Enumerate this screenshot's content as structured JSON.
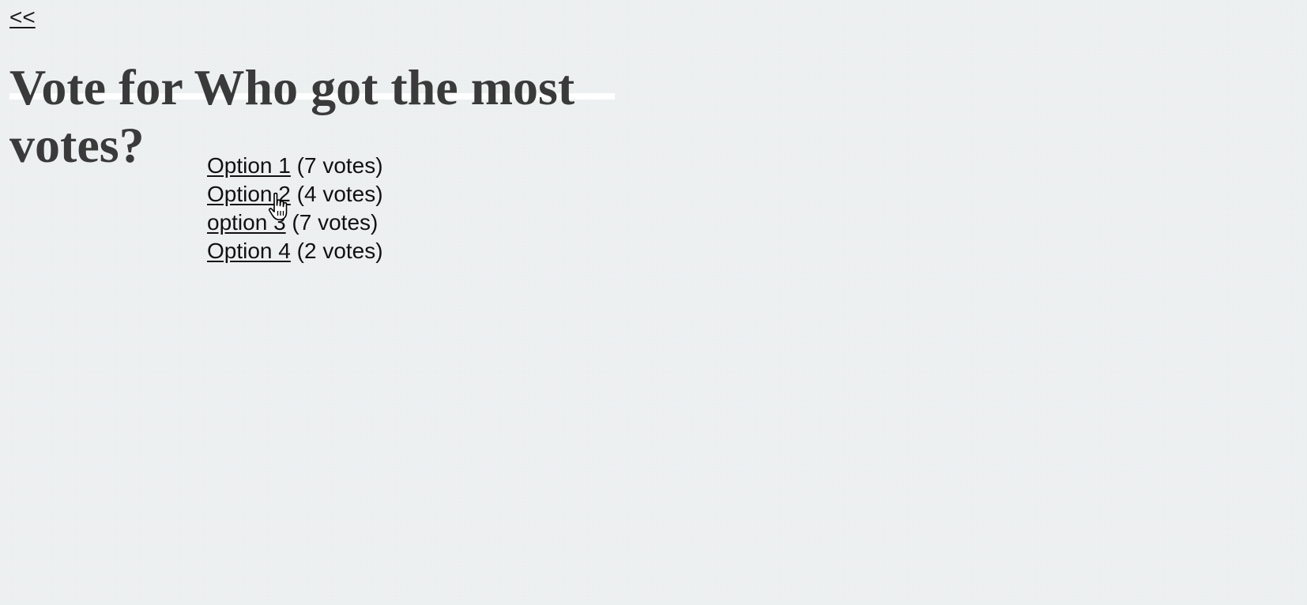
{
  "nav": {
    "back_label": "<<"
  },
  "page": {
    "title": "Vote for Who got the most votes?"
  },
  "options": [
    {
      "label": "Option 1",
      "votes": "(7 votes)"
    },
    {
      "label": "Option 2",
      "votes": "(4 votes)"
    },
    {
      "label": "option 3",
      "votes": "(7 votes)"
    },
    {
      "label": "Option 4",
      "votes": "(2 votes)"
    }
  ],
  "icons": {
    "cursor": "pointer-hand-icon"
  },
  "colors": {
    "background": "#eceff0",
    "title_text": "#3a3a3a",
    "body_text": "#111111",
    "title_highlight": "#ffffff"
  }
}
